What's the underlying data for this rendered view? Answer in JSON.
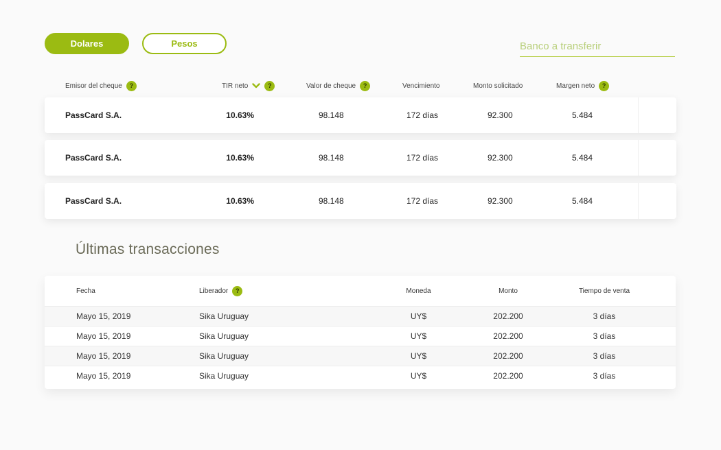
{
  "currency_toggle": {
    "primary": "Dolares",
    "secondary": "Pesos"
  },
  "bank_field": {
    "placeholder": "Banco a transferir"
  },
  "checks_table": {
    "headers": {
      "issuer": "Emisor del cheque",
      "tir": "TIR neto",
      "value": "Valor de cheque",
      "due": "Vencimiento",
      "requested": "Monto solicitado",
      "margin": "Margen neto"
    },
    "help_glyph": "?",
    "rows": [
      {
        "issuer": "PassCard S.A.",
        "tir": "10.63%",
        "value": "98.148",
        "due": "172 días",
        "requested": "92.300",
        "margin": "5.484"
      },
      {
        "issuer": "PassCard S.A.",
        "tir": "10.63%",
        "value": "98.148",
        "due": "172 días",
        "requested": "92.300",
        "margin": "5.484"
      },
      {
        "issuer": "PassCard S.A.",
        "tir": "10.63%",
        "value": "98.148",
        "due": "172 días",
        "requested": "92.300",
        "margin": "5.484"
      }
    ]
  },
  "transactions": {
    "title": "Últimas transacciones",
    "headers": {
      "date": "Fecha",
      "releaser": "Liberador",
      "currency": "Moneda",
      "amount": "Monto",
      "sale_time": "Tiempo de venta"
    },
    "rows": [
      {
        "date": "Mayo 15, 2019",
        "releaser": "Sika Uruguay",
        "currency": "UY$",
        "amount": "202.200",
        "sale_time": "3 días"
      },
      {
        "date": "Mayo 15, 2019",
        "releaser": "Sika Uruguay",
        "currency": "UY$",
        "amount": "202.200",
        "sale_time": "3 días"
      },
      {
        "date": "Mayo 15, 2019",
        "releaser": "Sika Uruguay",
        "currency": "UY$",
        "amount": "202.200",
        "sale_time": "3 días"
      },
      {
        "date": "Mayo 15, 2019",
        "releaser": "Sika Uruguay",
        "currency": "UY$",
        "amount": "202.200",
        "sale_time": "3 días"
      }
    ]
  },
  "colors": {
    "accent": "#9bbb12",
    "title": "#6b6b58"
  }
}
